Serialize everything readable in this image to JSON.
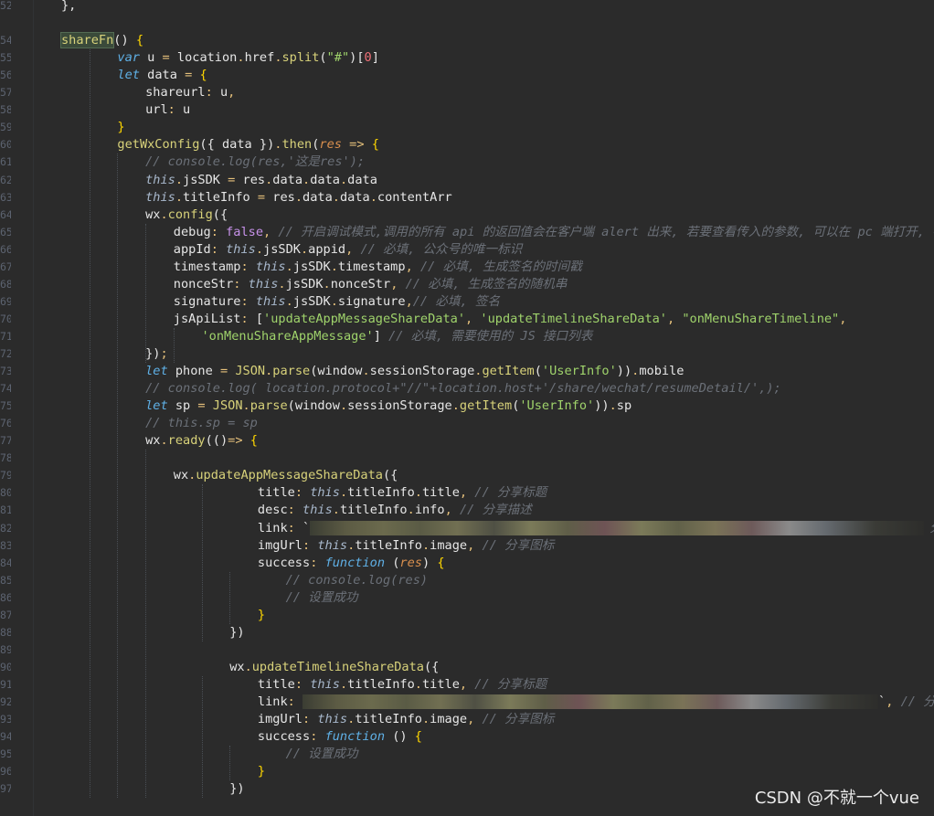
{
  "gutter": {
    "line_numbers": [
      "52",
      "",
      "54",
      "55",
      "56",
      "57",
      "58",
      "59",
      "60",
      "61",
      "62",
      "63",
      "64",
      "65",
      "66",
      "67",
      "68",
      "69",
      "70",
      "71",
      "72",
      "73",
      "74",
      "75",
      "76",
      "77",
      "78",
      "79",
      "80",
      "81",
      "82",
      "83",
      "84",
      "85",
      "86",
      "87",
      "88",
      "89",
      "90",
      "91",
      "92",
      "93",
      "94",
      "95",
      "96",
      "97"
    ]
  },
  "lines": [
    {
      "indent": 0,
      "tokens": [
        [
          "pn",
          "},"
        ]
      ]
    },
    {
      "indent": 0,
      "tokens": []
    },
    {
      "indent": 0,
      "tokens": [
        [
          "hlfn",
          "shareFn"
        ],
        [
          "pn",
          "() "
        ],
        [
          "br",
          "{"
        ]
      ]
    },
    {
      "indent": 2,
      "tokens": [
        [
          "kw",
          "var"
        ],
        [
          "pn",
          " u "
        ],
        [
          "op",
          "="
        ],
        [
          "pn",
          " location"
        ],
        [
          "op",
          "."
        ],
        [
          "prop",
          "href"
        ],
        [
          "op",
          "."
        ],
        [
          "fn",
          "split"
        ],
        [
          "pn",
          "("
        ],
        [
          "str",
          "\"#\""
        ],
        [
          "pn",
          ")"
        ],
        [
          "pn",
          "["
        ],
        [
          "num",
          "0"
        ],
        [
          "pn",
          "]"
        ]
      ]
    },
    {
      "indent": 2,
      "tokens": [
        [
          "kw",
          "let"
        ],
        [
          "pn",
          " data "
        ],
        [
          "op",
          "="
        ],
        [
          "pn",
          " "
        ],
        [
          "br",
          "{"
        ]
      ]
    },
    {
      "indent": 3,
      "tokens": [
        [
          "prop",
          "shareurl"
        ],
        [
          "op",
          ":"
        ],
        [
          "pn",
          " u"
        ],
        [
          "op",
          ","
        ]
      ]
    },
    {
      "indent": 3,
      "tokens": [
        [
          "prop",
          "url"
        ],
        [
          "op",
          ":"
        ],
        [
          "pn",
          " u"
        ]
      ]
    },
    {
      "indent": 2,
      "tokens": [
        [
          "br",
          "}"
        ]
      ]
    },
    {
      "indent": 2,
      "tokens": [
        [
          "fn",
          "getWxConfig"
        ],
        [
          "pn",
          "({ data })"
        ],
        [
          "op",
          "."
        ],
        [
          "fn",
          "then"
        ],
        [
          "pn",
          "("
        ],
        [
          "param",
          "res"
        ],
        [
          "pn",
          " "
        ],
        [
          "op",
          "=>"
        ],
        [
          "pn",
          " "
        ],
        [
          "br",
          "{"
        ]
      ]
    },
    {
      "indent": 3,
      "tokens": [
        [
          "cm",
          "// console.log(res,'这是res');"
        ]
      ]
    },
    {
      "indent": 3,
      "tokens": [
        [
          "this",
          "this"
        ],
        [
          "op",
          "."
        ],
        [
          "prop",
          "jsSDK"
        ],
        [
          "pn",
          " "
        ],
        [
          "op",
          "="
        ],
        [
          "pn",
          " res"
        ],
        [
          "op",
          "."
        ],
        [
          "prop",
          "data"
        ],
        [
          "op",
          "."
        ],
        [
          "prop",
          "data"
        ],
        [
          "op",
          "."
        ],
        [
          "prop",
          "data"
        ]
      ]
    },
    {
      "indent": 3,
      "tokens": [
        [
          "this",
          "this"
        ],
        [
          "op",
          "."
        ],
        [
          "prop",
          "titleInfo"
        ],
        [
          "pn",
          " "
        ],
        [
          "op",
          "="
        ],
        [
          "pn",
          " res"
        ],
        [
          "op",
          "."
        ],
        [
          "prop",
          "data"
        ],
        [
          "op",
          "."
        ],
        [
          "prop",
          "data"
        ],
        [
          "op",
          "."
        ],
        [
          "prop",
          "contentArr"
        ]
      ]
    },
    {
      "indent": 3,
      "tokens": [
        [
          "pn",
          "wx"
        ],
        [
          "op",
          "."
        ],
        [
          "fn",
          "config"
        ],
        [
          "pn",
          "({"
        ]
      ]
    },
    {
      "indent": 4,
      "tokens": [
        [
          "prop",
          "debug"
        ],
        [
          "op",
          ":"
        ],
        [
          "pn",
          " "
        ],
        [
          "bool",
          "false"
        ],
        [
          "op",
          ","
        ],
        [
          "pn",
          " "
        ],
        [
          "cm",
          "// 开启调试模式,调用的所有 api 的返回值会在客户端 alert 出来, 若要查看传入的参数, 可以在 pc 端打开, 参数"
        ]
      ]
    },
    {
      "indent": 4,
      "tokens": [
        [
          "prop",
          "appId"
        ],
        [
          "op",
          ":"
        ],
        [
          "pn",
          " "
        ],
        [
          "this",
          "this"
        ],
        [
          "op",
          "."
        ],
        [
          "prop",
          "jsSDK"
        ],
        [
          "op",
          "."
        ],
        [
          "prop",
          "appid"
        ],
        [
          "op",
          ","
        ],
        [
          "pn",
          " "
        ],
        [
          "cm",
          "// 必填, 公众号的唯一标识"
        ]
      ]
    },
    {
      "indent": 4,
      "tokens": [
        [
          "prop",
          "timestamp"
        ],
        [
          "op",
          ":"
        ],
        [
          "pn",
          " "
        ],
        [
          "this",
          "this"
        ],
        [
          "op",
          "."
        ],
        [
          "prop",
          "jsSDK"
        ],
        [
          "op",
          "."
        ],
        [
          "prop",
          "timestamp"
        ],
        [
          "op",
          ","
        ],
        [
          "pn",
          " "
        ],
        [
          "cm",
          "// 必填, 生成签名的时间戳"
        ]
      ]
    },
    {
      "indent": 4,
      "tokens": [
        [
          "prop",
          "nonceStr"
        ],
        [
          "op",
          ":"
        ],
        [
          "pn",
          " "
        ],
        [
          "this",
          "this"
        ],
        [
          "op",
          "."
        ],
        [
          "prop",
          "jsSDK"
        ],
        [
          "op",
          "."
        ],
        [
          "prop",
          "nonceStr"
        ],
        [
          "op",
          ","
        ],
        [
          "pn",
          " "
        ],
        [
          "cm",
          "// 必填, 生成签名的随机串"
        ]
      ]
    },
    {
      "indent": 4,
      "tokens": [
        [
          "prop",
          "signature"
        ],
        [
          "op",
          ":"
        ],
        [
          "pn",
          " "
        ],
        [
          "this",
          "this"
        ],
        [
          "op",
          "."
        ],
        [
          "prop",
          "jsSDK"
        ],
        [
          "op",
          "."
        ],
        [
          "prop",
          "signature"
        ],
        [
          "op",
          ","
        ],
        [
          "cm",
          "// 必填, 签名"
        ]
      ]
    },
    {
      "indent": 4,
      "tokens": [
        [
          "prop",
          "jsApiList"
        ],
        [
          "op",
          ":"
        ],
        [
          "pn",
          " ["
        ],
        [
          "str",
          "'updateAppMessageShareData'"
        ],
        [
          "op",
          ","
        ],
        [
          "pn",
          " "
        ],
        [
          "str",
          "'updateTimelineShareData'"
        ],
        [
          "op",
          ","
        ],
        [
          "pn",
          " "
        ],
        [
          "str",
          "\"onMenuShareTimeline\""
        ],
        [
          "op",
          ","
        ]
      ]
    },
    {
      "indent": 5,
      "tokens": [
        [
          "str",
          "'onMenuShareAppMessage'"
        ],
        [
          "pn",
          "] "
        ],
        [
          "cm",
          "// 必填, 需要使用的 JS 接口列表"
        ]
      ]
    },
    {
      "indent": 3,
      "tokens": [
        [
          "pn",
          "})"
        ],
        [
          "op",
          ";"
        ]
      ]
    },
    {
      "indent": 3,
      "tokens": [
        [
          "kw",
          "let"
        ],
        [
          "pn",
          " phone "
        ],
        [
          "op",
          "="
        ],
        [
          "pn",
          " "
        ],
        [
          "fn",
          "JSON"
        ],
        [
          "op",
          "."
        ],
        [
          "fn",
          "parse"
        ],
        [
          "pn",
          "(window"
        ],
        [
          "op",
          "."
        ],
        [
          "prop",
          "sessionStorage"
        ],
        [
          "op",
          "."
        ],
        [
          "fn",
          "getItem"
        ],
        [
          "pn",
          "("
        ],
        [
          "str",
          "'UserInfo'"
        ],
        [
          "pn",
          "))"
        ],
        [
          "op",
          "."
        ],
        [
          "prop",
          "mobile"
        ]
      ]
    },
    {
      "indent": 3,
      "tokens": [
        [
          "cm",
          "// console.log( location.protocol+\"//\"+location.host+'/share/wechat/resumeDetail/',);"
        ]
      ]
    },
    {
      "indent": 3,
      "tokens": [
        [
          "kw",
          "let"
        ],
        [
          "pn",
          " sp "
        ],
        [
          "op",
          "="
        ],
        [
          "pn",
          " "
        ],
        [
          "fn",
          "JSON"
        ],
        [
          "op",
          "."
        ],
        [
          "fn",
          "parse"
        ],
        [
          "pn",
          "(window"
        ],
        [
          "op",
          "."
        ],
        [
          "prop",
          "sessionStorage"
        ],
        [
          "op",
          "."
        ],
        [
          "fn",
          "getItem"
        ],
        [
          "pn",
          "("
        ],
        [
          "str",
          "'UserInfo'"
        ],
        [
          "pn",
          "))"
        ],
        [
          "op",
          "."
        ],
        [
          "prop",
          "sp"
        ]
      ]
    },
    {
      "indent": 3,
      "tokens": [
        [
          "cm",
          "// this.sp = sp"
        ]
      ]
    },
    {
      "indent": 3,
      "tokens": [
        [
          "pn",
          "wx"
        ],
        [
          "op",
          "."
        ],
        [
          "fn",
          "ready"
        ],
        [
          "pn",
          "(()"
        ],
        [
          "op",
          "=>"
        ],
        [
          "pn",
          " "
        ],
        [
          "br",
          "{"
        ]
      ]
    },
    {
      "indent": 0,
      "tokens": []
    },
    {
      "indent": 4,
      "tokens": [
        [
          "pn",
          "wx"
        ],
        [
          "op",
          "."
        ],
        [
          "fn",
          "updateAppMessageShareData"
        ],
        [
          "pn",
          "({"
        ]
      ]
    },
    {
      "indent": 7,
      "tokens": [
        [
          "prop",
          "title"
        ],
        [
          "op",
          ":"
        ],
        [
          "pn",
          " "
        ],
        [
          "this",
          "this"
        ],
        [
          "op",
          "."
        ],
        [
          "prop",
          "titleInfo"
        ],
        [
          "op",
          "."
        ],
        [
          "prop",
          "title"
        ],
        [
          "op",
          ","
        ],
        [
          "pn",
          " "
        ],
        [
          "cm",
          "// 分享标题"
        ]
      ]
    },
    {
      "indent": 7,
      "tokens": [
        [
          "prop",
          "desc"
        ],
        [
          "op",
          ":"
        ],
        [
          "pn",
          " "
        ],
        [
          "this",
          "this"
        ],
        [
          "op",
          "."
        ],
        [
          "prop",
          "titleInfo"
        ],
        [
          "op",
          "."
        ],
        [
          "prop",
          "info"
        ],
        [
          "op",
          ","
        ],
        [
          "pn",
          " "
        ],
        [
          "cm",
          "// 分享描述"
        ]
      ]
    },
    {
      "indent": 7,
      "tokens": [
        [
          "prop",
          "link"
        ],
        [
          "op",
          ":"
        ],
        [
          "pn",
          " `"
        ]
      ],
      "blur": "link1",
      "tail": [
        [
          "cm",
          "分"
        ]
      ]
    },
    {
      "indent": 7,
      "tokens": [
        [
          "prop",
          "imgUrl"
        ],
        [
          "op",
          ":"
        ],
        [
          "pn",
          " "
        ],
        [
          "this",
          "this"
        ],
        [
          "op",
          "."
        ],
        [
          "prop",
          "titleInfo"
        ],
        [
          "op",
          "."
        ],
        [
          "prop",
          "image"
        ],
        [
          "op",
          ","
        ],
        [
          "pn",
          " "
        ],
        [
          "cm",
          "// 分享图标"
        ]
      ]
    },
    {
      "indent": 7,
      "tokens": [
        [
          "prop",
          "success"
        ],
        [
          "op",
          ":"
        ],
        [
          "pn",
          " "
        ],
        [
          "kw",
          "function"
        ],
        [
          "pn",
          " ("
        ],
        [
          "param",
          "res"
        ],
        [
          "pn",
          ") "
        ],
        [
          "br",
          "{"
        ]
      ]
    },
    {
      "indent": 8,
      "tokens": [
        [
          "cm",
          "// console.log(res)"
        ]
      ]
    },
    {
      "indent": 8,
      "tokens": [
        [
          "cm",
          "// 设置成功"
        ]
      ]
    },
    {
      "indent": 7,
      "tokens": [
        [
          "br",
          "}"
        ]
      ]
    },
    {
      "indent": 6,
      "tokens": [
        [
          "pn",
          "})"
        ]
      ]
    },
    {
      "indent": 0,
      "tokens": []
    },
    {
      "indent": 6,
      "tokens": [
        [
          "pn",
          "wx"
        ],
        [
          "op",
          "."
        ],
        [
          "fn",
          "updateTimelineShareData"
        ],
        [
          "pn",
          "({"
        ]
      ]
    },
    {
      "indent": 7,
      "tokens": [
        [
          "prop",
          "title"
        ],
        [
          "op",
          ":"
        ],
        [
          "pn",
          " "
        ],
        [
          "this",
          "this"
        ],
        [
          "op",
          "."
        ],
        [
          "prop",
          "titleInfo"
        ],
        [
          "op",
          "."
        ],
        [
          "prop",
          "title"
        ],
        [
          "op",
          ","
        ],
        [
          "pn",
          " "
        ],
        [
          "cm",
          "// 分享标题"
        ]
      ]
    },
    {
      "indent": 7,
      "tokens": [
        [
          "prop",
          "link"
        ],
        [
          "op",
          ":"
        ],
        [
          "pn",
          " "
        ]
      ],
      "blur": "link2",
      "tail": [
        [
          "pn",
          "`"
        ],
        [
          "op",
          ","
        ],
        [
          "pn",
          " "
        ],
        [
          "cm",
          "// 分"
        ]
      ]
    },
    {
      "indent": 7,
      "tokens": [
        [
          "prop",
          "imgUrl"
        ],
        [
          "op",
          ":"
        ],
        [
          "pn",
          " "
        ],
        [
          "this",
          "this"
        ],
        [
          "op",
          "."
        ],
        [
          "prop",
          "titleInfo"
        ],
        [
          "op",
          "."
        ],
        [
          "prop",
          "image"
        ],
        [
          "op",
          ","
        ],
        [
          "pn",
          " "
        ],
        [
          "cm",
          "// 分享图标"
        ]
      ]
    },
    {
      "indent": 7,
      "tokens": [
        [
          "prop",
          "success"
        ],
        [
          "op",
          ":"
        ],
        [
          "pn",
          " "
        ],
        [
          "kw",
          "function"
        ],
        [
          "pn",
          " () "
        ],
        [
          "br",
          "{"
        ]
      ]
    },
    {
      "indent": 8,
      "tokens": [
        [
          "cm",
          "// 设置成功"
        ]
      ]
    },
    {
      "indent": 7,
      "tokens": [
        [
          "br",
          "}"
        ]
      ]
    },
    {
      "indent": 6,
      "tokens": [
        [
          "pn",
          "})"
        ]
      ]
    }
  ],
  "redactions": {
    "link1": "redacted-url",
    "link2": "redacted-url"
  },
  "watermark": "CSDN @不就一个vue",
  "colors": {
    "background": "#2b2b2b",
    "keyword": "#5fb0e6",
    "function": "#d8d27a",
    "string": "#9fd36b",
    "comment": "#6b7078"
  }
}
